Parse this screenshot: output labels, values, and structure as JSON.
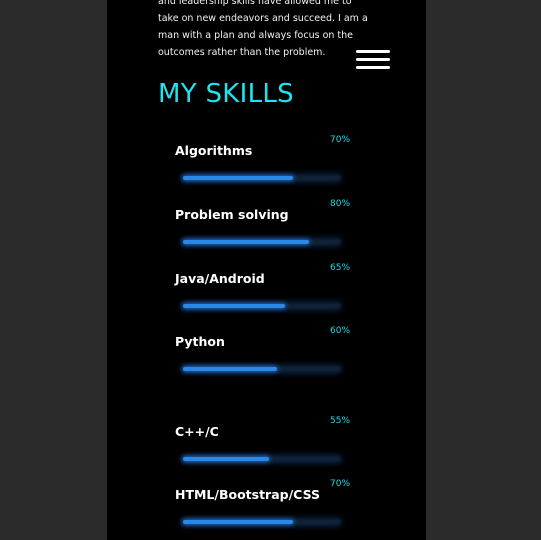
{
  "about": {
    "text": "and leadership skills have allowed me to take on new endeavors and succeed. I am a man with a plan and always focus on the outcomes rather than the problem."
  },
  "nav": {
    "menu_icon": "hamburger-menu-icon"
  },
  "skills_section": {
    "title": "MY SKILLS",
    "items": [
      {
        "name": "Algorithms",
        "percent_label": "70%",
        "level": 0.7
      },
      {
        "name": "Problem solving",
        "percent_label": "80%",
        "level": 0.8
      },
      {
        "name": "Java/Android",
        "percent_label": "65%",
        "level": 0.65
      },
      {
        "name": "Python",
        "percent_label": "60%",
        "level": 0.6
      },
      {
        "name": "C++/C",
        "percent_label": "55%",
        "level": 0.55
      },
      {
        "name": "HTML/Bootstrap/CSS",
        "percent_label": "70%",
        "level": 0.7
      }
    ]
  },
  "colors": {
    "background": "#000000",
    "outer_background": "#2b2b2b",
    "accent": "#1de4f0",
    "bar_fill": "#2a88e8",
    "bar_track": "#0f2235"
  }
}
